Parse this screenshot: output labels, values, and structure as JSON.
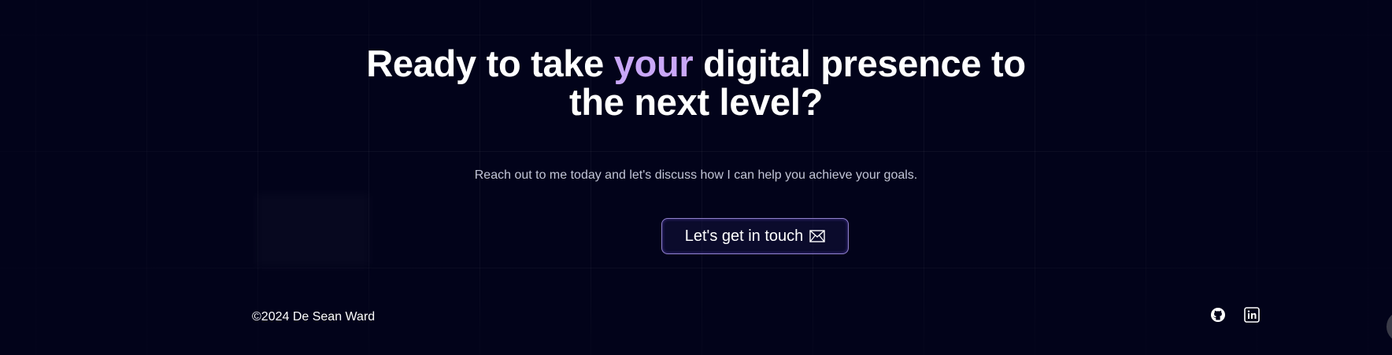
{
  "cta": {
    "headline_before": "Ready to take ",
    "headline_accent": "your",
    "headline_after": " digital presence to the next level?",
    "subtext": "Reach out to me today and let's discuss how I can help you achieve your goals.",
    "button_label": "Let's get in touch",
    "button_icon": "mail-icon"
  },
  "footer": {
    "copyright": "©2024 De Sean Ward",
    "social": [
      {
        "icon": "github-icon"
      },
      {
        "icon": "linkedin-icon"
      }
    ]
  },
  "colors": {
    "background": "#02031a",
    "accent": "#c9a7f7",
    "text": "#ffffff",
    "muted_text": "#c3c6d6",
    "button_border": "#bea9ff"
  }
}
